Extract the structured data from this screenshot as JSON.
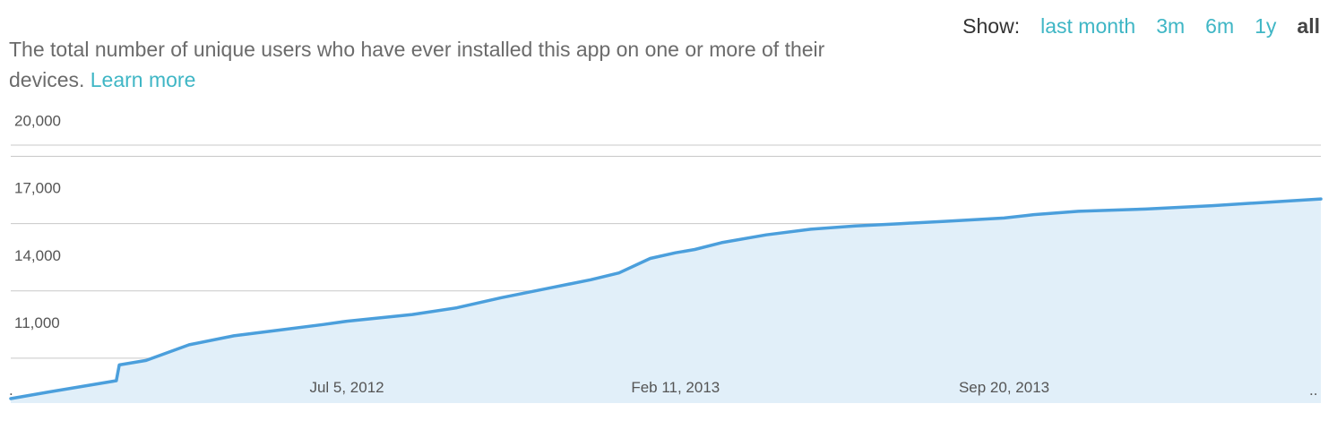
{
  "header": {
    "description": "The total number of unique users who have ever installed this app on one or more of their devices.",
    "learn_more": "Learn more"
  },
  "range_selector": {
    "label": "Show:",
    "options": [
      "last month",
      "3m",
      "6m",
      "1y",
      "all"
    ],
    "selected": "all"
  },
  "colors": {
    "line": "#4b9fdc",
    "fill": "#e1eff9",
    "grid": "#c8c8c8",
    "link": "#3fb6c5"
  },
  "chart_data": {
    "type": "area",
    "title": "",
    "xlabel": "",
    "ylabel": "",
    "ylim": [
      9000,
      20500
    ],
    "y_ticks": [
      11000,
      14000,
      17000,
      20000
    ],
    "y_tick_labels": [
      "11,000",
      "14,000",
      "17,000",
      "20,000"
    ],
    "x_tick_labels": [
      "Jul 5, 2012",
      "Feb 11, 2013",
      "Sep 20, 2013"
    ],
    "x_tick_dates": [
      "2012-07-05",
      "2013-02-11",
      "2013-09-20"
    ],
    "xlim": [
      "2011-11-22",
      "2014-04-21"
    ],
    "grid": true,
    "series": [
      {
        "name": "",
        "x": [
          "2011-11-22",
          "2011-12-18",
          "2012-01-14",
          "2012-02-01",
          "2012-02-03",
          "2012-02-21",
          "2012-03-21",
          "2012-04-20",
          "2012-05-20",
          "2012-06-19",
          "2012-07-05",
          "2012-08-18",
          "2012-09-17",
          "2012-10-17",
          "2012-11-16",
          "2012-12-16",
          "2013-01-04",
          "2013-01-25",
          "2013-02-11",
          "2013-02-24",
          "2013-03-14",
          "2013-04-13",
          "2013-05-13",
          "2013-06-12",
          "2013-07-12",
          "2013-08-11",
          "2013-09-20",
          "2013-10-10",
          "2013-11-09",
          "2013-12-24",
          "2014-02-07",
          "2014-04-21"
        ],
        "values": [
          9200,
          9500,
          9800,
          10000,
          10700,
          10900,
          11600,
          12000,
          12250,
          12500,
          12650,
          12950,
          13250,
          13700,
          14100,
          14500,
          14800,
          15450,
          15700,
          15850,
          16150,
          16500,
          16750,
          16900,
          17000,
          17100,
          17250,
          17400,
          17550,
          17650,
          17800,
          18100
        ]
      }
    ]
  }
}
